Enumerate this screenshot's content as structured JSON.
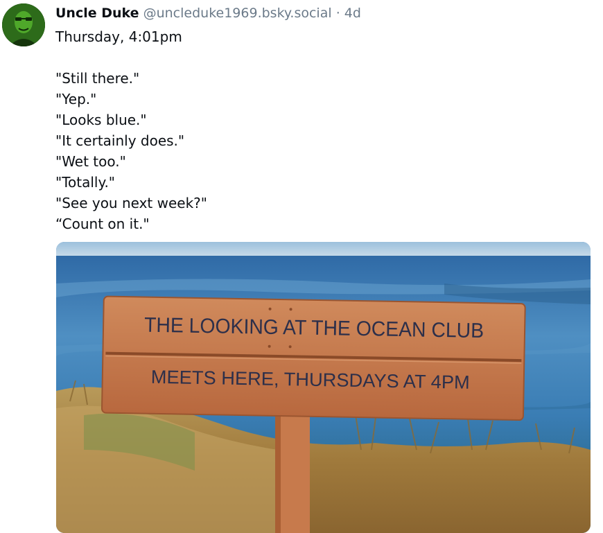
{
  "post": {
    "author": {
      "display_name": "Uncle Duke",
      "handle": "@uncleduke1969.bsky.social",
      "separator": "·",
      "time_ago": "4d"
    },
    "text_lines": [
      "Thursday, 4:01pm",
      "",
      "\"Still there.\"",
      "\"Yep.\"",
      "\"Looks blue.\"",
      "\"It certainly does.\"",
      "\"Wet too.\"",
      "\"Totally.\"",
      "\"See you next week?\"",
      "“Count on it.\""
    ],
    "image": {
      "sign_line_1": "THE LOOKING AT THE OCEAN CLUB",
      "sign_line_2": "MEETS HERE, THURSDAYS AT 4PM"
    }
  }
}
